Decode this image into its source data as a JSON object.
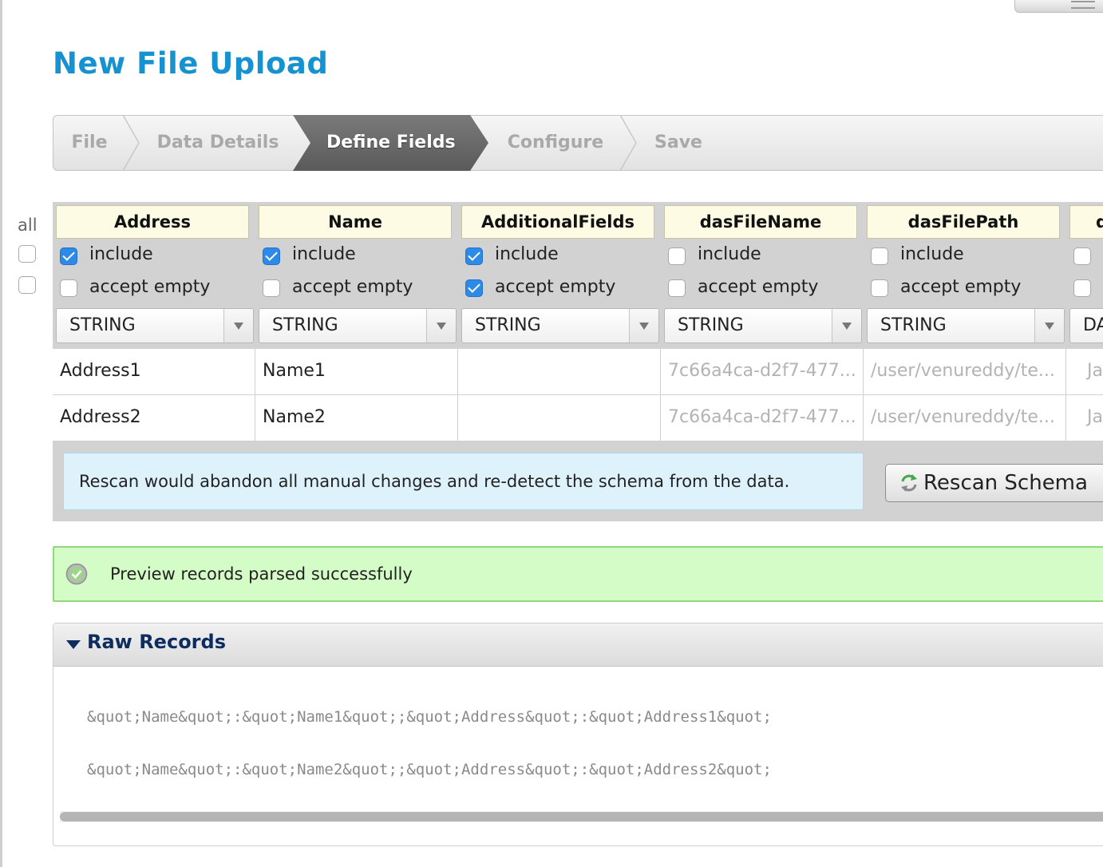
{
  "page": {
    "title": "New File Upload"
  },
  "wizard": {
    "steps": [
      {
        "label": "File",
        "active": false
      },
      {
        "label": "Data Details",
        "active": false
      },
      {
        "label": "Define Fields",
        "active": true
      },
      {
        "label": "Configure",
        "active": false
      },
      {
        "label": "Save",
        "active": false
      }
    ]
  },
  "schema": {
    "all_label": "all",
    "include_label": "include",
    "accept_empty_label": "accept empty",
    "columns": [
      {
        "name": "Address",
        "include": true,
        "accept_empty": false,
        "type": "STRING"
      },
      {
        "name": "Name",
        "include": true,
        "accept_empty": false,
        "type": "STRING"
      },
      {
        "name": "AdditionalFields",
        "include": true,
        "accept_empty": true,
        "type": "STRING"
      },
      {
        "name": "dasFileName",
        "include": false,
        "accept_empty": false,
        "type": "STRING"
      },
      {
        "name": "dasFilePath",
        "include": false,
        "accept_empty": false,
        "type": "STRING"
      },
      {
        "name": "d",
        "include": false,
        "accept_empty": false,
        "type": "DA"
      }
    ],
    "rows": [
      [
        "Address1",
        "Name1",
        "",
        "7c66a4ca-d2f7-477...",
        "/user/venureddy/te...",
        "Jan"
      ],
      [
        "Address2",
        "Name2",
        "",
        "7c66a4ca-d2f7-477...",
        "/user/venureddy/te...",
        "Jan"
      ]
    ],
    "notice": "Rescan would abandon all manual changes and re-detect the schema from the data.",
    "rescan_label": "Rescan Schema"
  },
  "status": {
    "message": "Preview records parsed successfully",
    "color": "#d4fcc6"
  },
  "raw_records": {
    "title": "Raw Records",
    "lines": [
      "&quot;Name&quot;:&quot;Name1&quot;;&quot;Address&quot;:&quot;Address1&quot;",
      "&quot;Name&quot;:&quot;Name2&quot;;&quot;Address&quot;:&quot;Address2&quot;"
    ]
  },
  "colors": {
    "accent": "#1592cf",
    "checkbox": "#2d8ae8",
    "header_bg": "#fdfbe3"
  }
}
